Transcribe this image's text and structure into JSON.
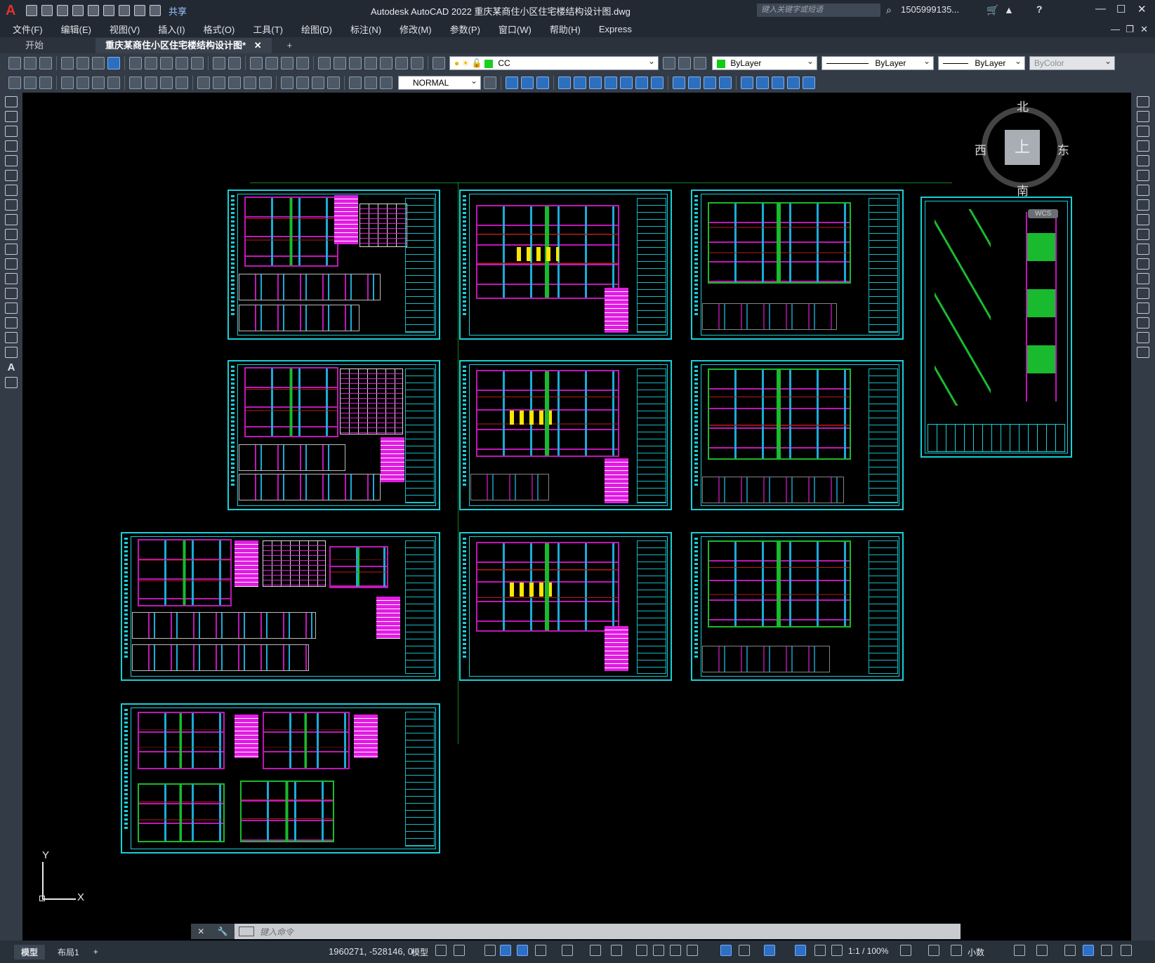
{
  "app": {
    "logo": "A",
    "title": "Autodesk AutoCAD 2022    重庆某商住小区住宅楼结构设计图.dwg",
    "share_label": "共享",
    "search_placeholder": "键入关键字或短语",
    "username": "1505999135...",
    "help_label": "?"
  },
  "menu": [
    "文件(F)",
    "编辑(E)",
    "视图(V)",
    "插入(I)",
    "格式(O)",
    "工具(T)",
    "绘图(D)",
    "标注(N)",
    "修改(M)",
    "参数(P)",
    "窗口(W)",
    "帮助(H)",
    "Express"
  ],
  "tabs": {
    "start": "开始",
    "document": "重庆某商住小区住宅楼结构设计图*",
    "close": "✕",
    "new": "+"
  },
  "toolbar": {
    "layer_value": "CC",
    "color_value": "ByLayer",
    "linetype_value": "ByLayer",
    "lineweight_value": "ByLayer",
    "plotstyle_value": "ByColor",
    "dimstyle_value": "NORMAL"
  },
  "viewcube": {
    "north": "北",
    "south": "南",
    "east": "东",
    "west": "西",
    "face": "上",
    "wcs": "WCS"
  },
  "ucs": {
    "y": "Y",
    "x": "X"
  },
  "command": {
    "placeholder": "键入命令"
  },
  "status": {
    "tab_model": "模型",
    "tab_layout1": "布局1",
    "tab_add": "+",
    "coords": "1960271, -528146, 0",
    "model_label": "模型",
    "scale": "1:1 / 100%",
    "units": "小数"
  },
  "colors": {
    "frame": "#18d0d9",
    "canvas": "#000000",
    "layer_swatch": "#19d01e",
    "color_swatch": "#12cc14",
    "accent": "#2e6fc4"
  }
}
